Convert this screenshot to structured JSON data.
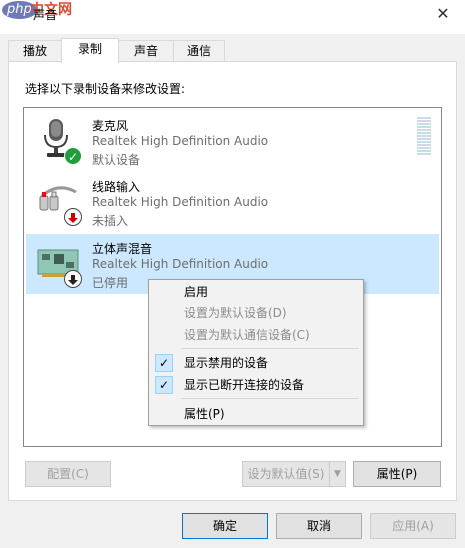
{
  "window": {
    "logo_php": "php",
    "logo_cn": "中文网",
    "title": "声音",
    "close_glyph": "✕"
  },
  "tabs": [
    {
      "label": "播放",
      "active": false
    },
    {
      "label": "录制",
      "active": true
    },
    {
      "label": "声音",
      "active": false
    },
    {
      "label": "通信",
      "active": false
    }
  ],
  "instruction": "选择以下录制设备来修改设置:",
  "devices": [
    {
      "name": "麦克风",
      "driver": "Realtek High Definition Audio",
      "status": "默认设备",
      "icon": "microphone-icon",
      "badge": "default-check-icon",
      "selected": false
    },
    {
      "name": "线路输入",
      "driver": "Realtek High Definition Audio",
      "status": "未插入",
      "icon": "line-in-cable-icon",
      "badge": "unplugged-arrow-icon",
      "selected": false
    },
    {
      "name": "立体声混音",
      "driver": "Realtek High Definition Audio",
      "status": "已停用",
      "icon": "sound-card-icon",
      "badge": "disabled-arrow-icon",
      "selected": true
    }
  ],
  "context_menu": {
    "enable": "启用",
    "set_default": "设置为默认设备(D)",
    "set_default_comm": "设置为默认通信设备(C)",
    "show_disabled": "显示禁用的设备",
    "show_disconnected": "显示已断开连接的设备",
    "properties": "属性(P)",
    "check_glyph": "✓"
  },
  "buttons": {
    "configure": "配置(C)",
    "set_default": "设为默认值(S)",
    "split_arrow": "▼",
    "properties": "属性(P)",
    "ok": "确定",
    "cancel": "取消",
    "apply": "应用(A)"
  },
  "colors": {
    "selection": "#cce8ff",
    "check_green": "#1e9e3c",
    "unplugged_red": "#d00000",
    "focus_blue": "#0078d7"
  }
}
